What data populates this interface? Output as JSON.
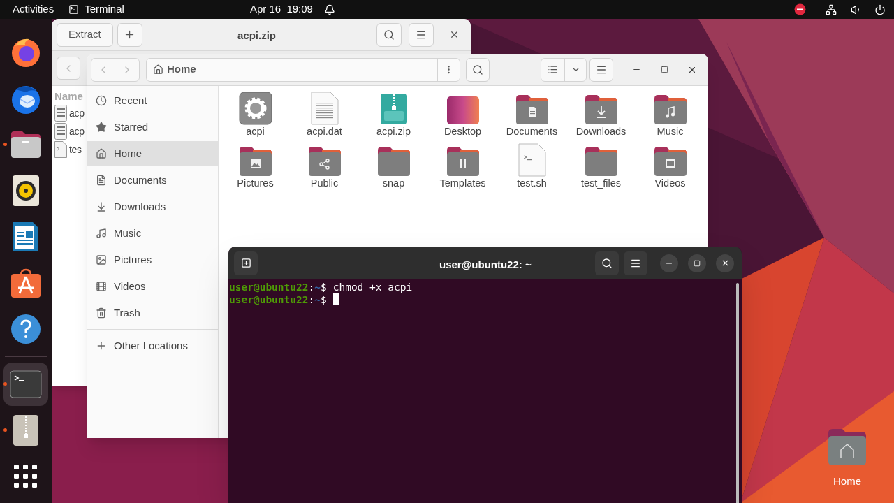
{
  "top_bar": {
    "activities": "Activities",
    "app": "Terminal",
    "clock": "Apr 16  19:09"
  },
  "dock": [
    {
      "kind": "browser",
      "running": false,
      "selected": false
    },
    {
      "kind": "mail",
      "running": false,
      "selected": false
    },
    {
      "kind": "files",
      "running": true,
      "selected": false
    },
    {
      "kind": "music",
      "running": false,
      "selected": false
    },
    {
      "kind": "writer",
      "running": false,
      "selected": false
    },
    {
      "kind": "software",
      "running": false,
      "selected": false
    },
    {
      "kind": "help",
      "running": false,
      "selected": false
    },
    {
      "kind": "terminal",
      "running": true,
      "selected": true
    },
    {
      "kind": "archive",
      "running": true,
      "selected": false
    },
    {
      "kind": "apps",
      "running": false,
      "selected": false
    }
  ],
  "desktop_icons": [
    {
      "label": "Home"
    }
  ],
  "archive_window": {
    "extract": "Extract",
    "title": "acpi.zip",
    "column_header": "Name",
    "files": [
      {
        "kind": "binary",
        "name": "acp"
      },
      {
        "kind": "binary",
        "name": "acp"
      },
      {
        "kind": "script",
        "name": "tes"
      }
    ]
  },
  "files_window": {
    "path": "Home",
    "sidebar": [
      {
        "kind": "recent",
        "label": "Recent",
        "selected": false
      },
      {
        "kind": "starred",
        "label": "Starred",
        "selected": false
      },
      {
        "kind": "home",
        "label": "Home",
        "selected": true
      },
      {
        "kind": "documents",
        "label": "Documents",
        "selected": false
      },
      {
        "kind": "downloads",
        "label": "Downloads",
        "selected": false
      },
      {
        "kind": "music",
        "label": "Music",
        "selected": false
      },
      {
        "kind": "pictures",
        "label": "Pictures",
        "selected": false
      },
      {
        "kind": "videos",
        "label": "Videos",
        "selected": false
      },
      {
        "kind": "trash",
        "label": "Trash",
        "selected": false
      },
      {
        "kind": "other",
        "label": "Other Locations",
        "selected": false
      }
    ],
    "items": [
      {
        "kind": "executable",
        "name": "acpi"
      },
      {
        "kind": "text",
        "name": "acpi.dat"
      },
      {
        "kind": "zip",
        "name": "acpi.zip"
      },
      {
        "kind": "desktop",
        "name": "Desktop"
      },
      {
        "kind": "documents",
        "name": "Documents"
      },
      {
        "kind": "downloads",
        "name": "Downloads"
      },
      {
        "kind": "music",
        "name": "Music"
      },
      {
        "kind": "pictures",
        "name": "Pictures"
      },
      {
        "kind": "public",
        "name": "Public"
      },
      {
        "kind": "folder",
        "name": "snap"
      },
      {
        "kind": "templates",
        "name": "Templates"
      },
      {
        "kind": "script",
        "name": "test.sh"
      },
      {
        "kind": "folder",
        "name": "test_files"
      },
      {
        "kind": "videos",
        "name": "Videos"
      }
    ]
  },
  "terminal": {
    "title": "user@ubuntu22: ~",
    "lines": [
      {
        "user": "user@ubuntu22",
        "separator": ":",
        "path": "~",
        "prompt": "$",
        "command": "chmod +x acpi",
        "cursor": false
      },
      {
        "user": "user@ubuntu22",
        "separator": ":",
        "path": "~",
        "prompt": "$",
        "cursor": true
      }
    ]
  }
}
